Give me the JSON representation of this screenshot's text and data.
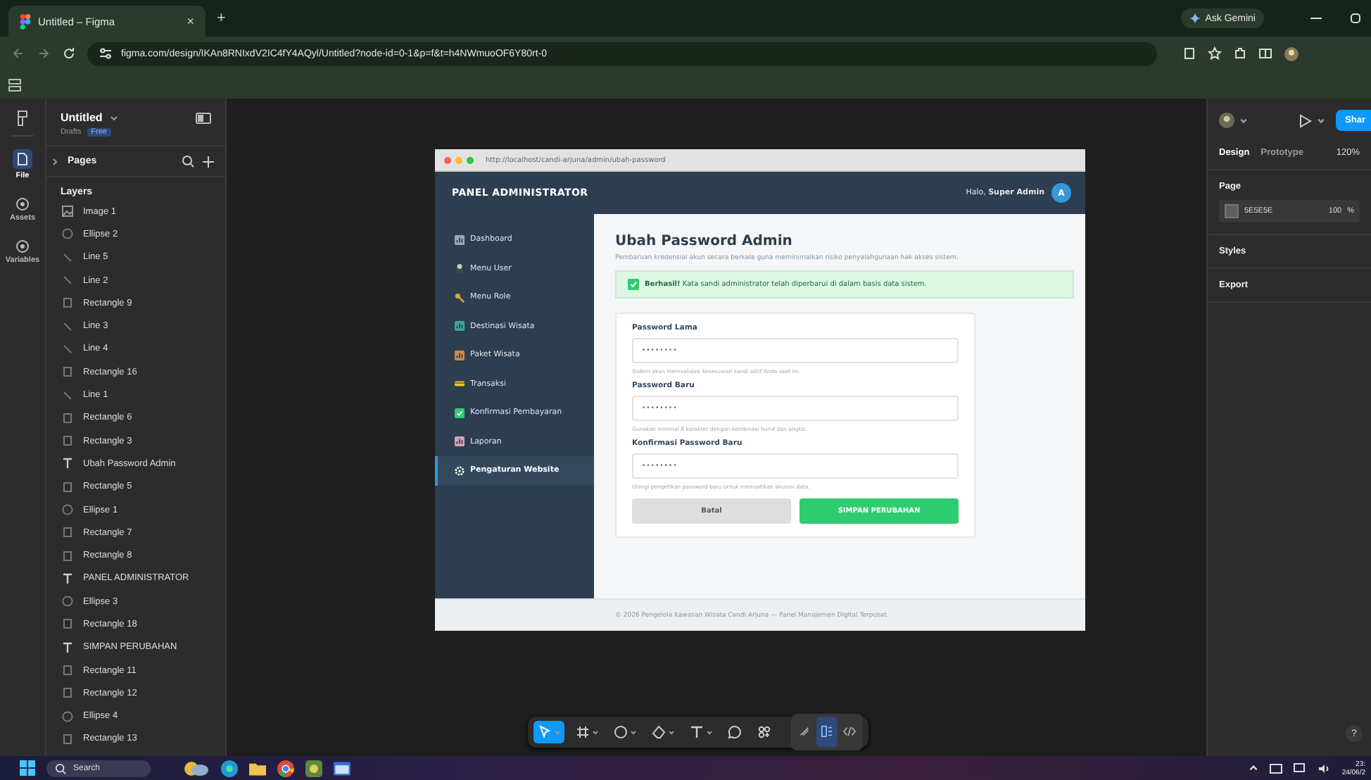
{
  "browser": {
    "tab_title": "Untitled – Figma",
    "tab_close": "×",
    "new_tab": "+",
    "ask_gemini": "Ask Gemini",
    "url": "figma.com/design/IKAn8RNIxdV2IC4fY4AQyl/Untitled?node-id=0-1&p=f&t=h4NWmuoOF6Y80rt-0"
  },
  "file": {
    "name": "Untitled",
    "location": "Drafts",
    "plan": "Free"
  },
  "rail": [
    {
      "label": "File",
      "selected": true
    },
    {
      "label": "Assets",
      "selected": false
    },
    {
      "label": "Variables",
      "selected": false
    }
  ],
  "pages_label": "Pages",
  "layers_label": "Layers",
  "layers": [
    {
      "name": "Image 1",
      "kind": "image"
    },
    {
      "name": "Ellipse 2",
      "kind": "ellipse"
    },
    {
      "name": "Line 5",
      "kind": "line"
    },
    {
      "name": "Line 2",
      "kind": "line"
    },
    {
      "name": "Rectangle 9",
      "kind": "rect"
    },
    {
      "name": "Line 3",
      "kind": "line"
    },
    {
      "name": "Line 4",
      "kind": "line"
    },
    {
      "name": "Rectangle 16",
      "kind": "rect"
    },
    {
      "name": "Line 1",
      "kind": "line"
    },
    {
      "name": "Rectangle 6",
      "kind": "rect"
    },
    {
      "name": "Rectangle 3",
      "kind": "rect"
    },
    {
      "name": "Ubah Password Admin",
      "kind": "text"
    },
    {
      "name": "Rectangle 5",
      "kind": "rect"
    },
    {
      "name": "Ellipse 1",
      "kind": "ellipse"
    },
    {
      "name": "Rectangle 7",
      "kind": "rect"
    },
    {
      "name": "Rectangle 8",
      "kind": "rect"
    },
    {
      "name": "PANEL ADMINISTRATOR",
      "kind": "text"
    },
    {
      "name": "Ellipse 3",
      "kind": "ellipse"
    },
    {
      "name": "Rectangle 18",
      "kind": "rect"
    },
    {
      "name": "SIMPAN PERUBAHAN",
      "kind": "text"
    },
    {
      "name": "Rectangle 11",
      "kind": "rect"
    },
    {
      "name": "Rectangle 12",
      "kind": "rect"
    },
    {
      "name": "Ellipse 4",
      "kind": "ellipse"
    },
    {
      "name": "Rectangle 13",
      "kind": "rect"
    }
  ],
  "design_panel": {
    "share": "Shar",
    "tabs": [
      {
        "label": "Design",
        "selected": true
      },
      {
        "label": "Prototype",
        "selected": false
      }
    ],
    "zoom": "120%",
    "page_label": "Page",
    "page_color": "5E5E5E",
    "page_opacity": "100",
    "percent": "%",
    "styles": "Styles",
    "export": "Export",
    "help": "?"
  },
  "mockup": {
    "url": "http://localhost/candi-arjuna/admin/ubah-password",
    "brand": "PANEL ADMINISTRATOR",
    "greeting": "Halo, **Super Admin**",
    "avatar": "A",
    "nav": [
      {
        "label": "Dashboard",
        "kind": "dashboard",
        "selected": false
      },
      {
        "label": "Menu User",
        "kind": "user",
        "selected": false
      },
      {
        "label": "Menu Role",
        "kind": "role",
        "selected": false
      },
      {
        "label": "Destinasi Wisata",
        "kind": "destination",
        "selected": false
      },
      {
        "label": "Paket Wisata",
        "kind": "package",
        "selected": false
      },
      {
        "label": "Transaksi",
        "kind": "transaction",
        "selected": false
      },
      {
        "label": "Konfirmasi Pembayaran",
        "kind": "confirm",
        "selected": false
      },
      {
        "label": "Laporan",
        "kind": "report",
        "selected": false
      },
      {
        "label": "Pengaturan Website",
        "kind": "settings",
        "selected": true
      }
    ],
    "title": "Ubah Password Admin",
    "subtitle": "Pembaruan kredensial akun secara berkala guna meminimalkan risiko penyalahgunaan hak akses sistem.",
    "alert": "**Berhasil!** Kata sandi administrator telah diperbarui di dalam basis data sistem.",
    "fields": [
      {
        "label": "Password Lama",
        "value": "••••••••",
        "hint": "Sistem akan memvalidasi kesesuaian sandi aktif Anda saat ini."
      },
      {
        "label": "Password Baru",
        "value": "••••••••",
        "hint": "Gunakan minimal 8 karakter dengan kombinasi huruf dan angka."
      },
      {
        "label": "Konfirmasi Password Baru",
        "value": "••••••••",
        "hint": "Ulangi pengetikan password baru untuk memastikan akurasi data."
      }
    ],
    "buttons": [
      {
        "label": "Batal",
        "kind": "secondary"
      },
      {
        "label": "SIMPAN PERUBAHAN",
        "kind": "primary"
      }
    ],
    "footer": "© 2026 Pengelola Kawasan Wisata Candi Arjuna — Panel Manajemen Digital Terpusat."
  },
  "toolbar": [
    {
      "kind": "move",
      "selected": true
    },
    {
      "kind": "frame",
      "selected": false
    },
    {
      "kind": "shape",
      "selected": false
    },
    {
      "kind": "pen",
      "selected": false
    },
    {
      "kind": "text",
      "selected": false
    },
    {
      "kind": "comment",
      "selected": false
    },
    {
      "kind": "actions",
      "selected": false
    }
  ],
  "modes": [
    {
      "kind": "draw",
      "selected": false
    },
    {
      "kind": "design",
      "selected": true
    },
    {
      "kind": "dev",
      "selected": false
    }
  ],
  "taskbar": {
    "search": "Search",
    "time": "23:",
    "date": "24/06/2"
  }
}
